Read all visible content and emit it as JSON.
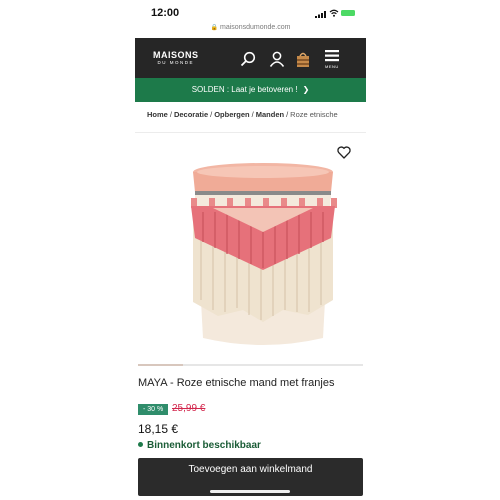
{
  "status_bar": {
    "time": "12:00"
  },
  "browser": {
    "url": "maisonsdumonde.com"
  },
  "header": {
    "logo_line1": "MAISONS",
    "logo_line2": "DU MONDE",
    "menu_label": "MENU",
    "icons": [
      "search-icon",
      "account-icon",
      "basket-icon",
      "menu-icon"
    ],
    "background_color": "#262626"
  },
  "promo": {
    "text": "SOLDEN : Laat je betoveren !",
    "color": "#1d7a4a"
  },
  "breadcrumb": {
    "items": [
      "Home",
      "Decoratie",
      "Opbergen",
      "Manden"
    ],
    "current": "Roze etnische"
  },
  "product": {
    "title": "MAYA - Roze etnische mand met franjes",
    "discount": "- 30 %",
    "old_price": "25,99 €",
    "price": "18,15 €",
    "availability": "Binnenkort beschikbaar",
    "add_to_cart": "Toevoegen aan winkelmand",
    "gallery_position": 0.2,
    "colors": {
      "discount": "#2f8d6b",
      "old_price": "#d2264c",
      "availability": "#1a5c36",
      "button": "#2b2b2b"
    }
  }
}
